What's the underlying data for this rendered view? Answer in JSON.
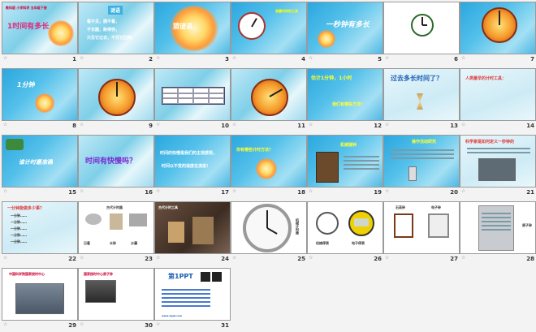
{
  "slides": [
    {
      "num": "1",
      "title": "1时间有多长",
      "subtitle": "教科版 小学科学 五年级下册"
    },
    {
      "num": "2",
      "lines": [
        "看不见，摸不着，",
        "不长腿，跑得快，",
        "只见它过去，不见它回来。"
      ]
    },
    {
      "num": "3",
      "title": "猜谜语"
    },
    {
      "num": "4",
      "text": "测量时间的工具"
    },
    {
      "num": "5",
      "title": "一秒钟有多长"
    },
    {
      "num": "6"
    },
    {
      "num": "7"
    },
    {
      "num": "8",
      "title": "1分钟"
    },
    {
      "num": "9"
    },
    {
      "num": "10"
    },
    {
      "num": "11"
    },
    {
      "num": "12",
      "title": "估计1分钟，1小时",
      "text": "我们有哪些方法？"
    },
    {
      "num": "13",
      "title": "过去多长时间了？"
    },
    {
      "num": "14",
      "title": "人类最早的计时工具："
    },
    {
      "num": "15",
      "title": "谁计时最准确"
    },
    {
      "num": "16",
      "title": "时间有快慢吗？"
    },
    {
      "num": "17",
      "lines": [
        "时间的快慢是我们的主观感受。",
        "时间以不变的速度在流逝！"
      ]
    },
    {
      "num": "18",
      "title": "你有哪些计时方法？"
    },
    {
      "num": "19",
      "text": "机械摆钟"
    },
    {
      "num": "20",
      "text": "操作活动研究"
    },
    {
      "num": "21",
      "title": "科学家是如何定义一秒钟的"
    },
    {
      "num": "22",
      "title": "一分钟能做多少事？",
      "lines": [
        "一分钟……",
        "一分钟……",
        "一分钟……",
        "一分钟……",
        "一分钟……"
      ]
    },
    {
      "num": "23",
      "title": "古代计时器",
      "labels": [
        "日晷",
        "水钟",
        "沙漏"
      ]
    },
    {
      "num": "24",
      "title": "古代计时工具"
    },
    {
      "num": "25",
      "text": "机械计时器"
    },
    {
      "num": "26",
      "labels": [
        "机械停表",
        "电子停表"
      ]
    },
    {
      "num": "27",
      "labels": [
        "石英钟",
        "电子钟"
      ]
    },
    {
      "num": "28",
      "text": "原子钟"
    },
    {
      "num": "29",
      "title": "中国科学院国家授时中心"
    },
    {
      "num": "30",
      "title": "国家授时中心原子钟"
    },
    {
      "num": "31",
      "title": "第1PPT",
      "text": "www.1ppt.com"
    }
  ]
}
